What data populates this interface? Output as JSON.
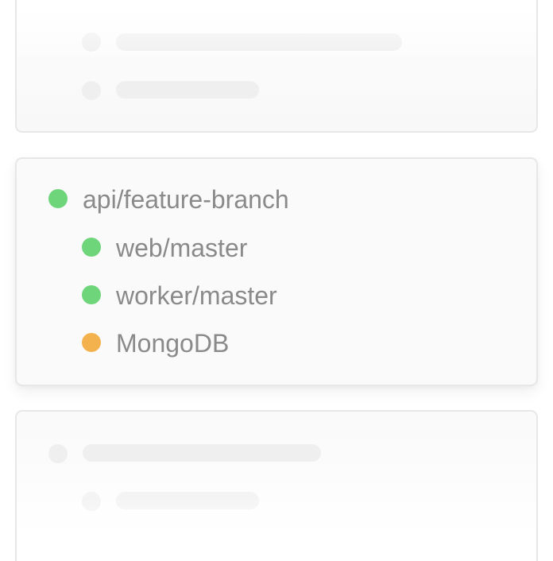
{
  "colors": {
    "green": "#6ed57a",
    "orange": "#f4b24f",
    "placeholder": "#efefef",
    "text": "#8a8a8a"
  },
  "main_card": {
    "items": [
      {
        "label": "api/feature-branch",
        "status": "green"
      },
      {
        "label": "web/master",
        "status": "green"
      },
      {
        "label": "worker/master",
        "status": "green"
      },
      {
        "label": "MongoDB",
        "status": "orange"
      }
    ]
  },
  "icons": {
    "status_green": "green-status-dot-icon",
    "status_orange": "orange-status-dot-icon",
    "skeleton_dot": "placeholder-dot-icon"
  }
}
